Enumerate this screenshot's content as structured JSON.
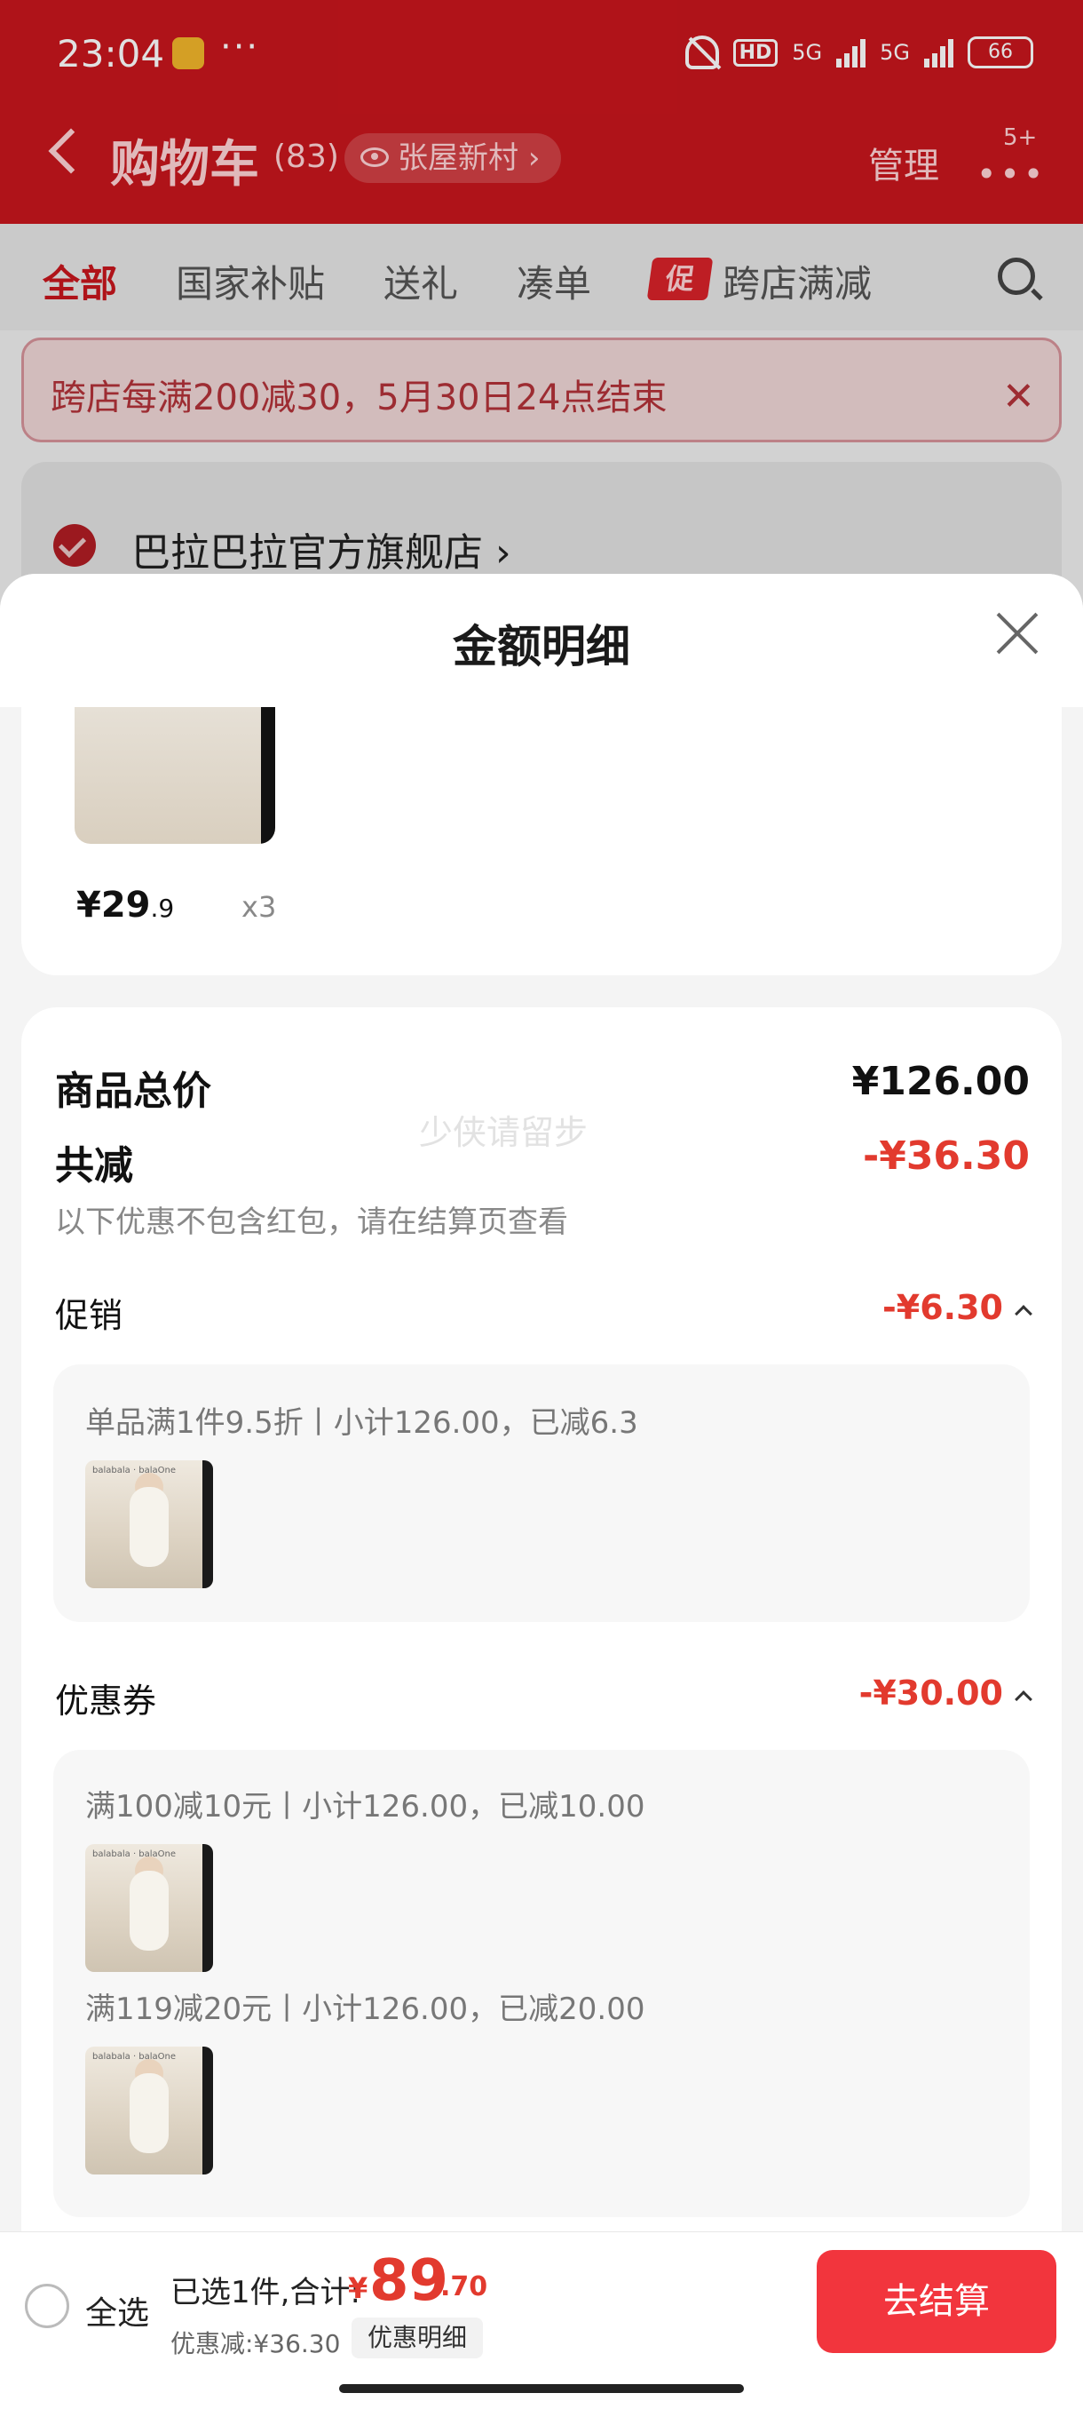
{
  "status_bar": {
    "time": "23:04",
    "dots": "···",
    "hd_label": "HD",
    "signal_1": "5G",
    "signal_2": "5G",
    "battery": "66"
  },
  "nav": {
    "title": "购物车",
    "count": "(83)",
    "location": "张屋新村",
    "location_chevron": "›",
    "manage": "管理",
    "more_badge": "5+"
  },
  "tabs": [
    {
      "label": "全部",
      "active": true
    },
    {
      "label": "国家补贴"
    },
    {
      "label": "送礼"
    },
    {
      "label": "凑单"
    },
    {
      "label": "跨店满减",
      "tag": "促"
    }
  ],
  "promo_banner": {
    "text": "跨店每满200减30，5月30日24点结束",
    "close": "✕"
  },
  "shop": {
    "name": "巴拉巴拉官方旗舰店",
    "chevron": "›"
  },
  "sheet": {
    "title": "金额明细",
    "item": {
      "price_int": "¥29",
      "price_dec": ".9",
      "qty": "x3"
    },
    "watermark": "少侠请留步",
    "total_label": "商品总价",
    "total_value": "¥126.00",
    "reduce_label": "共减",
    "reduce_value": "-¥36.30",
    "note": "以下优惠不包含红包，请在结算页查看",
    "promo_label": "促销",
    "promo_value": "-¥6.30",
    "promo_rules": [
      "单品满1件9.5折丨小计126.00，已减6.3"
    ],
    "coupon_label": "优惠券",
    "coupon_value": "-¥30.00",
    "coupon_rules": [
      "满100减10元丨小计126.00，已减10.00",
      "满119减20元丨小计126.00，已减20.00"
    ],
    "thumb_brand": "balabala · balaOne"
  },
  "bottom": {
    "select_all": "全选",
    "summary_prefix": "已选1件,合计:",
    "currency": "¥",
    "total_int": "89",
    "total_dec": ".70",
    "discount": "优惠减:¥36.30",
    "detail_button": "优惠明细",
    "checkout": "去结算"
  },
  "colors": {
    "brand_red": "#c8161d",
    "price_red": "#e23a2e",
    "checkout_red": "#f2353d"
  }
}
